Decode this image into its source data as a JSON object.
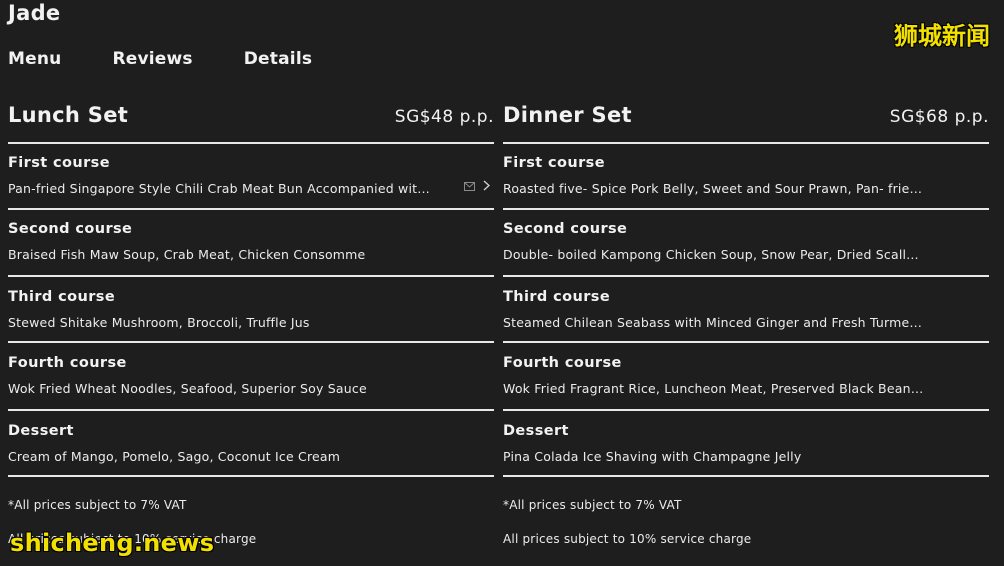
{
  "app": {
    "title": "Jade"
  },
  "tabs": [
    {
      "label": "Menu"
    },
    {
      "label": "Reviews"
    },
    {
      "label": "Details"
    }
  ],
  "watermarks": {
    "cn": "狮城新闻",
    "en": "shicheng.news"
  },
  "icons": {
    "envelope": "envelope-icon",
    "chevron": "chevron-right-icon"
  },
  "lunch": {
    "name": "Lunch Set",
    "price": "SG$48 p.p.",
    "courses": [
      {
        "name": "First course",
        "desc": "Pan-fried Singapore Style Chili Crab Meat Bun Accompanied wit…"
      },
      {
        "name": "Second course",
        "desc": "Braised Fish Maw Soup, Crab Meat, Chicken Consomme"
      },
      {
        "name": "Third course",
        "desc": "Stewed Shitake Mushroom, Broccoli, Truffle Jus"
      },
      {
        "name": "Fourth course",
        "desc": "Wok Fried Wheat Noodles, Seafood, Superior Soy Sauce"
      },
      {
        "name": "Dessert",
        "desc": "Cream of Mango, Pomelo, Sago, Coconut Ice Cream"
      }
    ],
    "notes": [
      "*All prices subject to 7% VAT",
      "All prices subject to 10% service charge"
    ]
  },
  "dinner": {
    "name": "Dinner Set",
    "price": "SG$68 p.p.",
    "courses": [
      {
        "name": "First course",
        "desc": "Roasted five- Spice Pork Belly, Sweet and Sour Prawn, Pan- frie…"
      },
      {
        "name": "Second course",
        "desc": "Double- boiled Kampong Chicken Soup, Snow Pear, Dried Scall…"
      },
      {
        "name": "Third course",
        "desc": "Steamed Chilean Seabass with Minced Ginger and Fresh Turme…"
      },
      {
        "name": "Fourth course",
        "desc": "Wok Fried Fragrant Rice, Luncheon Meat, Preserved Black Bean…"
      },
      {
        "name": "Dessert",
        "desc": "Pina Colada Ice Shaving with Champagne Jelly"
      }
    ],
    "notes": [
      "*All prices subject to 7% VAT",
      "All prices subject to 10% service charge"
    ]
  }
}
